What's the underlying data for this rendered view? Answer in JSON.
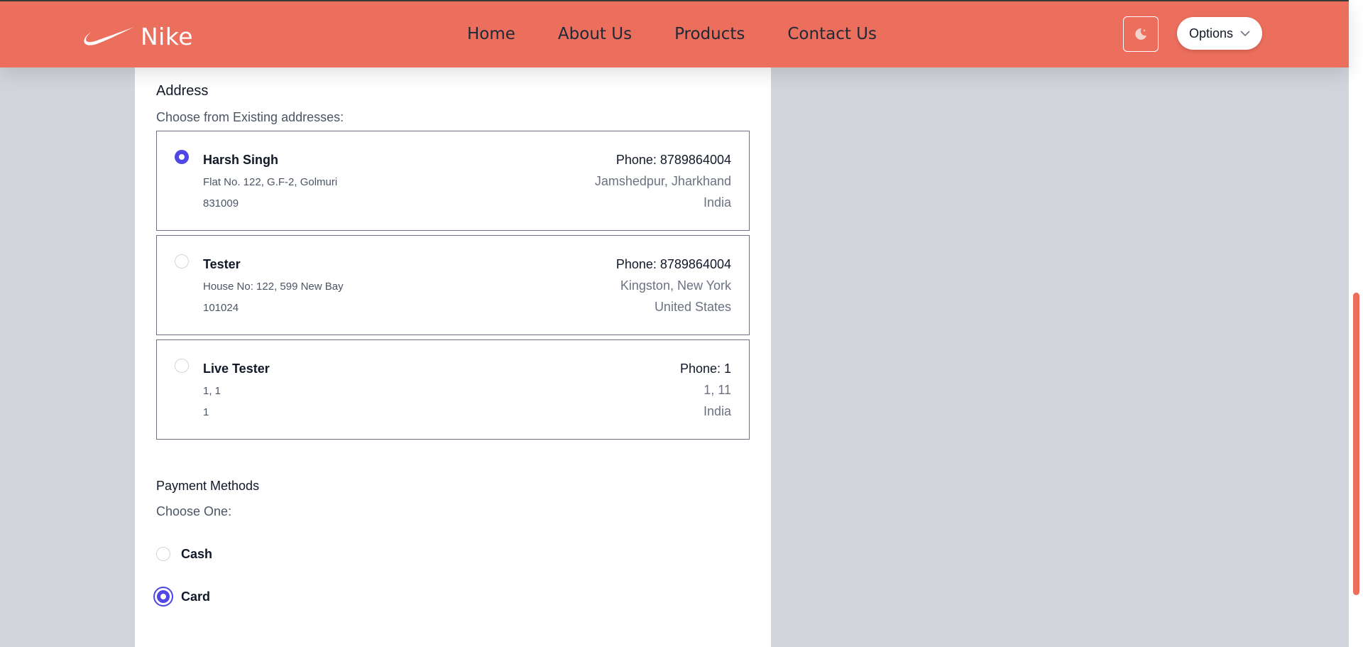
{
  "navbar": {
    "brand": "Nike",
    "links": [
      "Home",
      "About Us",
      "Products",
      "Contact Us"
    ],
    "theme_icon": "moon-icon",
    "options_label": "Options",
    "accent_color": "#ec6e5c"
  },
  "address": {
    "title": "Address",
    "subtitle": "Choose from Existing addresses:",
    "items": [
      {
        "name": "Harsh Singh",
        "street": "Flat No. 122, G.F-2, Golmuri",
        "pincode": "831009",
        "phone": "Phone: 8789864004",
        "city_state": "Jamshedpur, Jharkhand",
        "country": "India",
        "selected": true
      },
      {
        "name": "Tester",
        "street": "House No: 122, 599 New Bay",
        "pincode": "101024",
        "phone": "Phone: 8789864004",
        "city_state": "Kingston, New York",
        "country": "United States",
        "selected": false
      },
      {
        "name": "Live Tester",
        "street": "1, 1",
        "pincode": "1",
        "phone": "Phone: 1",
        "city_state": "1, 11",
        "country": "India",
        "selected": false
      }
    ]
  },
  "payment": {
    "title": "Payment Methods",
    "subtitle": "Choose One:",
    "options": [
      {
        "label": "Cash",
        "selected": false
      },
      {
        "label": "Card",
        "selected": true
      }
    ],
    "radio_color": "#4f46e5"
  }
}
